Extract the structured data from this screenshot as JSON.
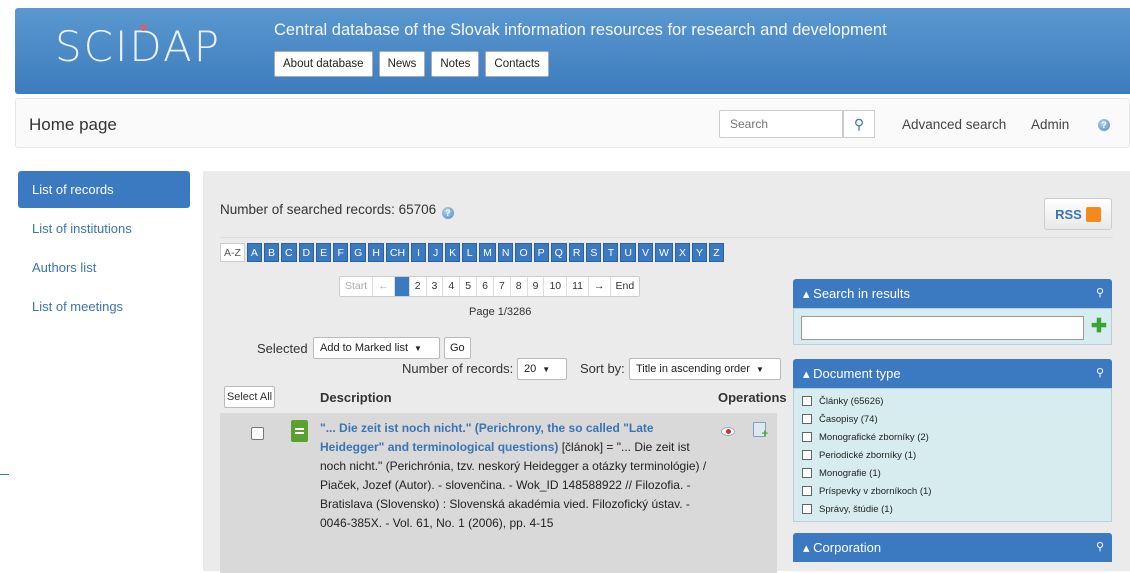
{
  "header": {
    "logo": "SCIDAP",
    "tagline": "Central database of the Slovak information resources for research and development",
    "nav": [
      "About database",
      "News",
      "Notes",
      "Contacts"
    ]
  },
  "navbar": {
    "home": "Home page",
    "search_placeholder": "Search",
    "advanced": "Advanced search",
    "admin": "Admin"
  },
  "sidebar": {
    "items": [
      "List of records",
      "List of institutions",
      "Authors list",
      "List of meetings"
    ]
  },
  "main": {
    "count_text": "Number of searched records: 65706",
    "rss": "RSS",
    "az": [
      "A-Z",
      "A",
      "B",
      "C",
      "D",
      "E",
      "F",
      "G",
      "H",
      "CH",
      "I",
      "J",
      "K",
      "L",
      "M",
      "N",
      "O",
      "P",
      "Q",
      "R",
      "S",
      "T",
      "U",
      "V",
      "W",
      "X",
      "Y",
      "Z"
    ],
    "pager": {
      "start": "Start",
      "prev": "←",
      "pages": [
        "1",
        "2",
        "3",
        "4",
        "5",
        "6",
        "7",
        "8",
        "9",
        "10",
        "11"
      ],
      "next": "→",
      "end": "End",
      "current": 1
    },
    "page_info": "Page 1/3286",
    "selected_label": "Selected",
    "selected_action": "Add to Marked list",
    "go": "Go",
    "num_records_label": "Number of records:",
    "num_records": "20",
    "sort_label": "Sort by:",
    "sort_value": "Title in ascending order",
    "select_all": "Select All",
    "col_description": "Description",
    "col_operations": "Operations",
    "record": {
      "title": "\"... Die zeit ist noch nicht.\" (Perichrony, the so called \"Late Heidegger\" and terminological questions)",
      "body": " [článok] = \"... Die zeit ist noch nicht.\" (Perichrónia, tzv. neskorý Heidegger a otázky terminológie) / Piaček, Jozef (Autor). - slovenčina. - Wok_ID 148588922 // Filozofia. - Bratislava (Slovensko) : Slovenská akadémia vied. Filozofický ústav. - 0046-385X. - Vol. 61, No. 1 (2006), pp. 4-15"
    }
  },
  "panels": {
    "search_in_results": "Search in results",
    "document_type": "Document type",
    "doc_types": [
      "Články (65626)",
      "Časopisy (74)",
      "Monografické zborníky (2)",
      "Periodické zborníky (1)",
      "Monografie (1)",
      "Príspevky v zborníkoch (1)",
      "Správy, štúdie (1)"
    ],
    "corporation": "Corporation"
  }
}
